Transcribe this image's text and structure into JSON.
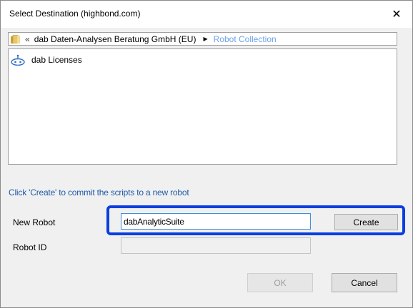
{
  "window": {
    "title": "Select Destination  (highbond.com)",
    "close_glyph": "✕"
  },
  "breadcrumb": {
    "folder_icon": "folder-icon",
    "back_glyph": "«",
    "organization": "dab Daten-Analysen  Beratung GmbH (EU)",
    "separator_glyph": "▶",
    "current": "Robot Collection"
  },
  "list": {
    "items": [
      {
        "icon": "robot-icon",
        "label": "dab Licenses"
      }
    ]
  },
  "hint": "Click 'Create' to commit the scripts to a new robot",
  "form": {
    "new_robot_label": "New Robot",
    "new_robot_value": "dabAnalyticSuite",
    "robot_id_label": "Robot ID",
    "robot_id_value": "",
    "create_label": "Create"
  },
  "footer": {
    "ok_label": "OK",
    "cancel_label": "Cancel"
  },
  "colors": {
    "hint_text": "#1f5ba8",
    "breadcrumb_current": "#6fa3e8",
    "highlight_border": "#0a3ee0"
  }
}
